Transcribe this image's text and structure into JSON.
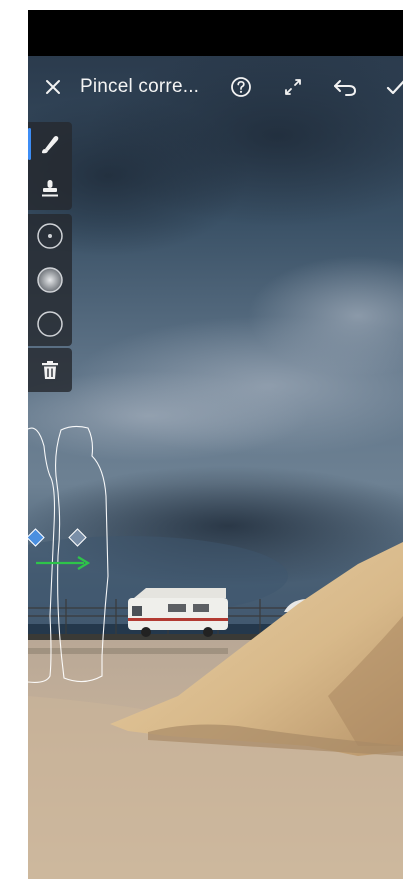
{
  "screen": {
    "title": "Pincel corre...",
    "icons": {
      "close": "close-icon",
      "help": "help-icon",
      "expand": "expand-icon",
      "undo": "undo-icon",
      "confirm": "checkmark-icon"
    }
  },
  "tools": [
    {
      "name": "brush",
      "icon": "brush-icon",
      "selected": true
    },
    {
      "name": "stamp",
      "icon": "stamp-icon",
      "selected": false
    }
  ],
  "brush_options": [
    {
      "name": "small",
      "icon": "brush-small-icon"
    },
    {
      "name": "medium",
      "icon": "brush-feather-icon"
    },
    {
      "name": "large",
      "icon": "brush-large-icon"
    }
  ],
  "actions": [
    {
      "name": "delete",
      "icon": "trash-icon"
    }
  ],
  "colors": {
    "accent": "#3d8df5",
    "pin_blue": "#4a8fe0",
    "arrow_green": "#2ec44a",
    "toolbar_bg": "#262a30"
  }
}
